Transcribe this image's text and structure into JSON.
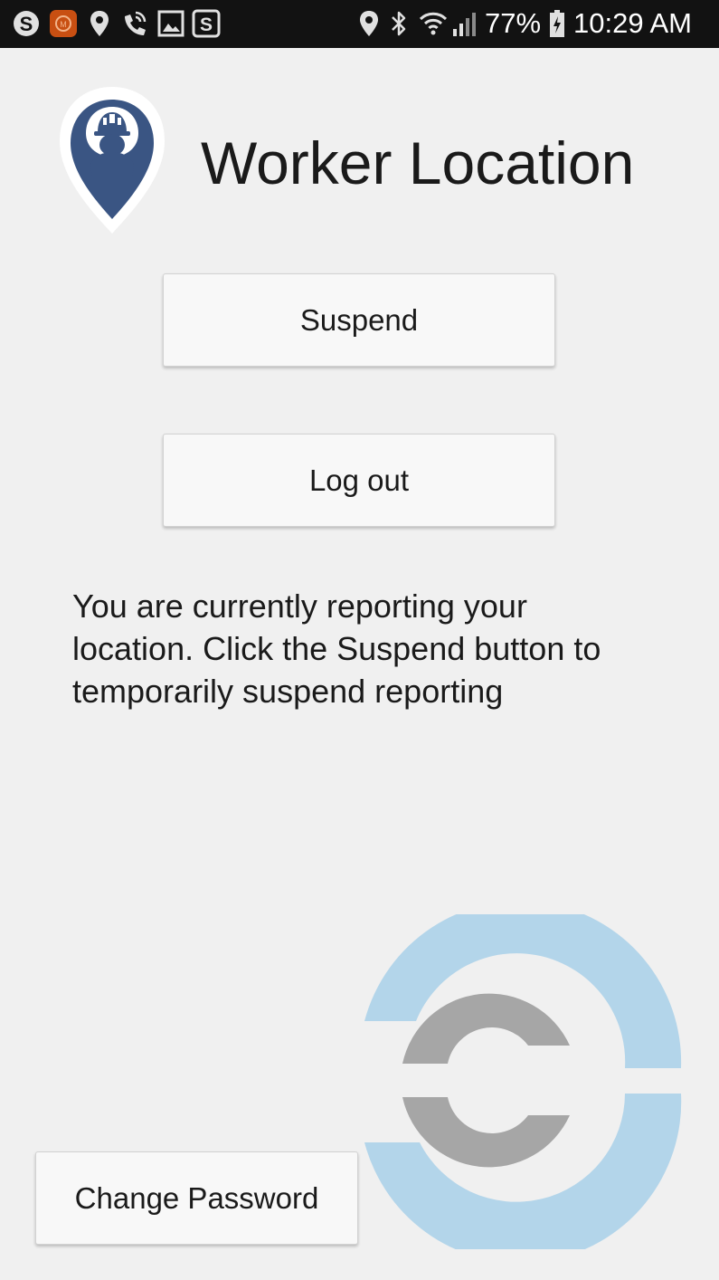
{
  "status_bar": {
    "battery_percent": "77%",
    "time": "10:29 AM",
    "left_icons": [
      "skype-icon",
      "notification-app-icon",
      "location-pin-icon",
      "wifi-calling-icon",
      "gallery-icon",
      "s-app-icon"
    ],
    "right_icons": [
      "location-icon",
      "bluetooth-icon",
      "wifi-icon",
      "signal-icon",
      "battery-charging-icon"
    ]
  },
  "header": {
    "title": "Worker Location",
    "logo_icon": "worker-location-pin-icon",
    "logo_color": "#3a5583"
  },
  "actions": {
    "suspend_label": "Suspend",
    "logout_label": "Log out"
  },
  "message": "You are currently reporting your location. Click the Suspend button to temporarily suspend reporting",
  "footer": {
    "change_password_label": "Change Password",
    "watermark_icon": "brand-logo-icon"
  },
  "colors": {
    "background": "#f0f0f0",
    "status_bar": "#121212",
    "watermark_blue": "#b3d5ea",
    "watermark_gray": "#a6a6a6"
  }
}
